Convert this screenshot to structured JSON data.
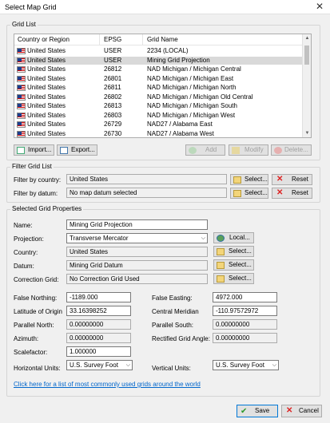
{
  "window": {
    "title": "Select Map Grid",
    "close_glyph": "✕"
  },
  "grid_list": {
    "group_title": "Grid List",
    "columns": [
      "Country or Region",
      "EPSG",
      "Grid Name"
    ],
    "rows": [
      {
        "country": "United States",
        "epsg": "USER",
        "name": "2234 (LOCAL)",
        "selected": false
      },
      {
        "country": "United States",
        "epsg": "USER",
        "name": "Mining Grid Projection",
        "selected": true
      },
      {
        "country": "United States",
        "epsg": "26812",
        "name": "NAD Michigan / Michigan Central",
        "selected": false
      },
      {
        "country": "United States",
        "epsg": "26801",
        "name": "NAD Michigan / Michigan East",
        "selected": false
      },
      {
        "country": "United States",
        "epsg": "26811",
        "name": "NAD Michigan / Michigan North",
        "selected": false
      },
      {
        "country": "United States",
        "epsg": "26802",
        "name": "NAD Michigan / Michigan Old Central",
        "selected": false
      },
      {
        "country": "United States",
        "epsg": "26813",
        "name": "NAD Michigan / Michigan South",
        "selected": false
      },
      {
        "country": "United States",
        "epsg": "26803",
        "name": "NAD Michigan / Michigan West",
        "selected": false
      },
      {
        "country": "United States",
        "epsg": "26729",
        "name": "NAD27 / Alabama East",
        "selected": false
      },
      {
        "country": "United States",
        "epsg": "26730",
        "name": "NAD27 / Alabama West",
        "selected": false
      }
    ],
    "buttons": {
      "import": "Import...",
      "export": "Export...",
      "add": "Add",
      "modify": "Modify",
      "delete": "Delete..."
    }
  },
  "filter": {
    "group_title": "Filter Grid List",
    "country_label": "Filter by country:",
    "country_value": "United States",
    "datum_label": "Filter by datum:",
    "datum_value": "No map datum selected",
    "select_label": "Select...",
    "reset_label": "Reset"
  },
  "properties": {
    "group_title": "Selected Grid Properties",
    "name_label": "Name:",
    "name_value": "Mining Grid Projection",
    "projection_label": "Projection:",
    "projection_value": "Transverse Mercator",
    "local_label": "Local...",
    "country_label": "Country:",
    "country_value": "United States",
    "datum_label": "Datum:",
    "datum_value": "Mining Grid Datum",
    "correction_label": "Correction Grid:",
    "correction_value": "No Correction Grid Used",
    "select_label": "Select...",
    "false_northing_label": "False Northing:",
    "false_northing_value": "-1189.000",
    "false_easting_label": "False Easting:",
    "false_easting_value": "4972.000",
    "lat_origin_label": "Latitude of Origin",
    "lat_origin_value": "33.16398252",
    "central_meridian_label": "Central Meridian",
    "central_meridian_value": "-110.97572972",
    "parallel_north_label": "Parallel North:",
    "parallel_north_value": "0.00000000",
    "parallel_south_label": "Parallel South:",
    "parallel_south_value": "0.00000000",
    "azimuth_label": "Azimuth:",
    "azimuth_value": "0.00000000",
    "rectified_label": "Rectified Grid Angle:",
    "rectified_value": "0.00000000",
    "scalefactor_label": "Scalefactor:",
    "scalefactor_value": "1.000000",
    "h_units_label": "Horizontal Units:",
    "h_units_value": "U.S. Survey Foot",
    "v_units_label": "Vertical Units:",
    "v_units_value": "U.S. Survey Foot",
    "link_text": "Click here for a list of most commonly used grids around the world"
  },
  "footer": {
    "save": "Save",
    "cancel": "Cancel"
  },
  "colors": {
    "accent_link": "#0066cc",
    "selected_row": "#d9d9d9",
    "error_red": "#dd2222"
  }
}
